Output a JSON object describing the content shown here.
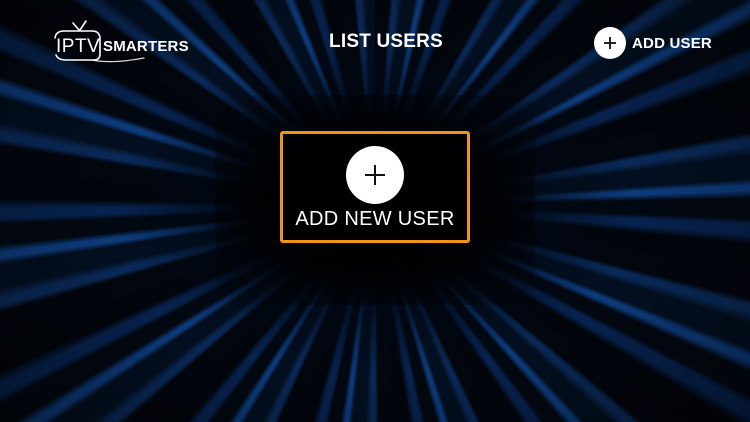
{
  "app": {
    "logo_part1": "IPTV",
    "logo_part2": "SMARTERS",
    "logo_icon": "tv-antenna-icon"
  },
  "header": {
    "title": "LIST USERS",
    "add_user_label": "ADD USER",
    "add_user_icon": "plus-icon"
  },
  "main": {
    "add_new_user_label": "ADD NEW USER",
    "add_new_user_icon": "plus-icon"
  },
  "colors": {
    "accent_focus": "#f2911b",
    "background_ray": "#0d3e82",
    "background_dark": "#000000",
    "text": "#ffffff"
  }
}
